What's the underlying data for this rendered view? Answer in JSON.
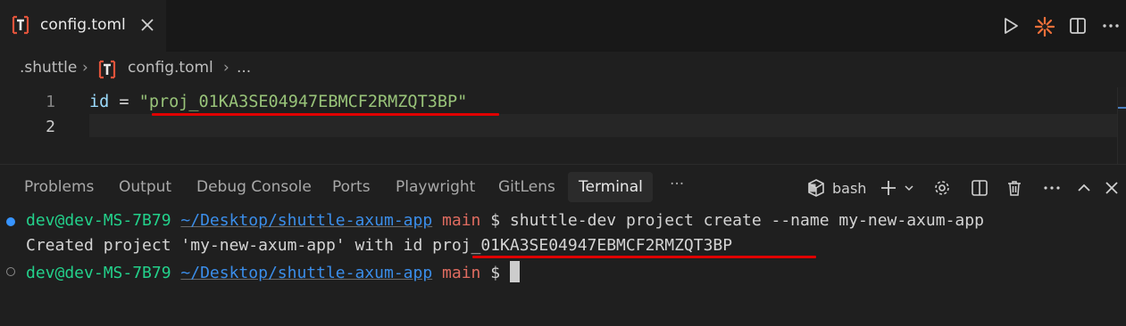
{
  "tab": {
    "filename": "config.toml"
  },
  "breadcrumb": {
    "segments": [
      ".shuttle",
      "config.toml",
      "..."
    ],
    "separator": "›"
  },
  "editor": {
    "lines": [
      {
        "number": "1",
        "key": "id",
        "op": " = ",
        "value": "\"proj_01KA3SE04947EBMCF2RMZQT3BP\""
      },
      {
        "number": "2",
        "key": "",
        "op": "",
        "value": ""
      }
    ]
  },
  "panel": {
    "tabs": [
      "Problems",
      "Output",
      "Debug Console",
      "Ports",
      "Playwright",
      "GitLens",
      "Terminal"
    ],
    "active_tab": "Terminal",
    "more": "···",
    "shell": "bash"
  },
  "terminal": {
    "line1": {
      "user": "dev@dev-MS-7B79",
      "path": "~/Desktop/shuttle-axum-app",
      "branch": "main",
      "prompt": "$",
      "command": "shuttle-dev project create --name my-new-axum-app"
    },
    "line2": {
      "text_before": "Created project 'my-new-axum-app' with id ",
      "project_id": "proj_01KA3SE04947EBMCF2RMZQT3BP"
    },
    "line3": {
      "user": "dev@dev-MS-7B79",
      "path": "~/Desktop/shuttle-axum-app",
      "branch": "main",
      "prompt": "$"
    }
  },
  "colors": {
    "background": "#1f1f1f",
    "string": "#98c379",
    "terminal_user": "#23d18b",
    "terminal_path": "#3b8eea",
    "terminal_branch": "#e06c60",
    "annotation": "#e00000",
    "toml_icon": "#e0533b"
  },
  "icons": {
    "tab": "toml-file-icon",
    "tab_close": "close-icon",
    "run": "play-icon",
    "ai": "sparkle-icon",
    "split": "split-editor-icon",
    "more": "ellipsis-icon"
  }
}
